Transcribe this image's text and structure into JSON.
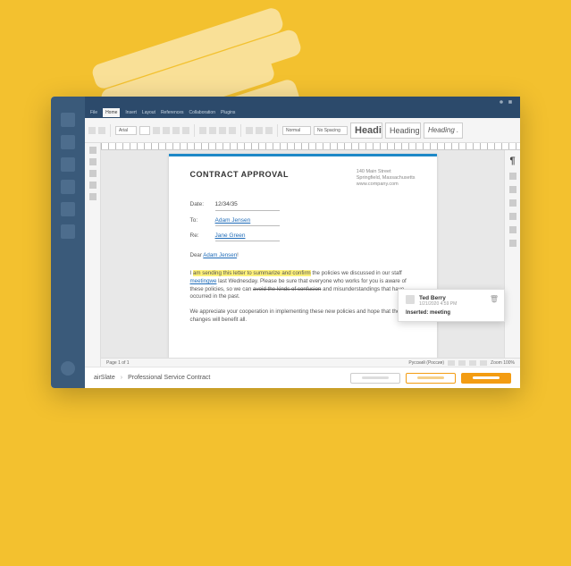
{
  "menubar": {
    "items": [
      "File",
      "Home",
      "Insert",
      "Layout",
      "References",
      "Collaboration",
      "Plugins"
    ],
    "active": "Home"
  },
  "toolbar": {
    "font": "Arial",
    "para_style1": "Normal",
    "para_style2": "No Spacing",
    "heading_big": "Headi",
    "heading_mid": "Heading",
    "heading_italic": "Heading ."
  },
  "document": {
    "title": "CONTRACT APPROVAL",
    "address": {
      "line1": "140 Main Street",
      "line2": "Springfield, Massachusetts",
      "line3": "www.company.com"
    },
    "fields": {
      "date_label": "Date:",
      "date_value": "12/34/35",
      "to_label": "To:",
      "to_value": "Adam Jensen",
      "re_label": "Re:",
      "re_value": "Jane Green"
    },
    "salutation_pre": "Dear ",
    "salutation_name": "Adam Jensen",
    "salutation_post": "!",
    "para1_start": "I ",
    "para1_hl": "am sending this letter to summarize and confirm",
    "para1_mid1": " the policies we discussed in our staff ",
    "para1_ins": "meeting",
    "para1_ins2": "we",
    "para1_mid2": " last Wednesday. Please be sure that everyone who works for you is aware of these policies, so we can ",
    "para1_strike": "avoid the kinds of confusion",
    "para1_end": " and misunderstandings that have occurred in the past.",
    "para2": "We appreciate your cooperation in implementing these new policies and hope that the changes will benefit all."
  },
  "statusbar": {
    "page": "Page 1 of 1",
    "lang": "Русский (Россия)",
    "zoom": "Zoom 100%"
  },
  "footer": {
    "crumb1": "airSlate",
    "crumb2": "Professional Service Contract"
  },
  "comment": {
    "author": "Ted Berry",
    "date": "1/21/2020 4:59 PM",
    "action_label": "Inserted:",
    "action_value": "meeting"
  }
}
